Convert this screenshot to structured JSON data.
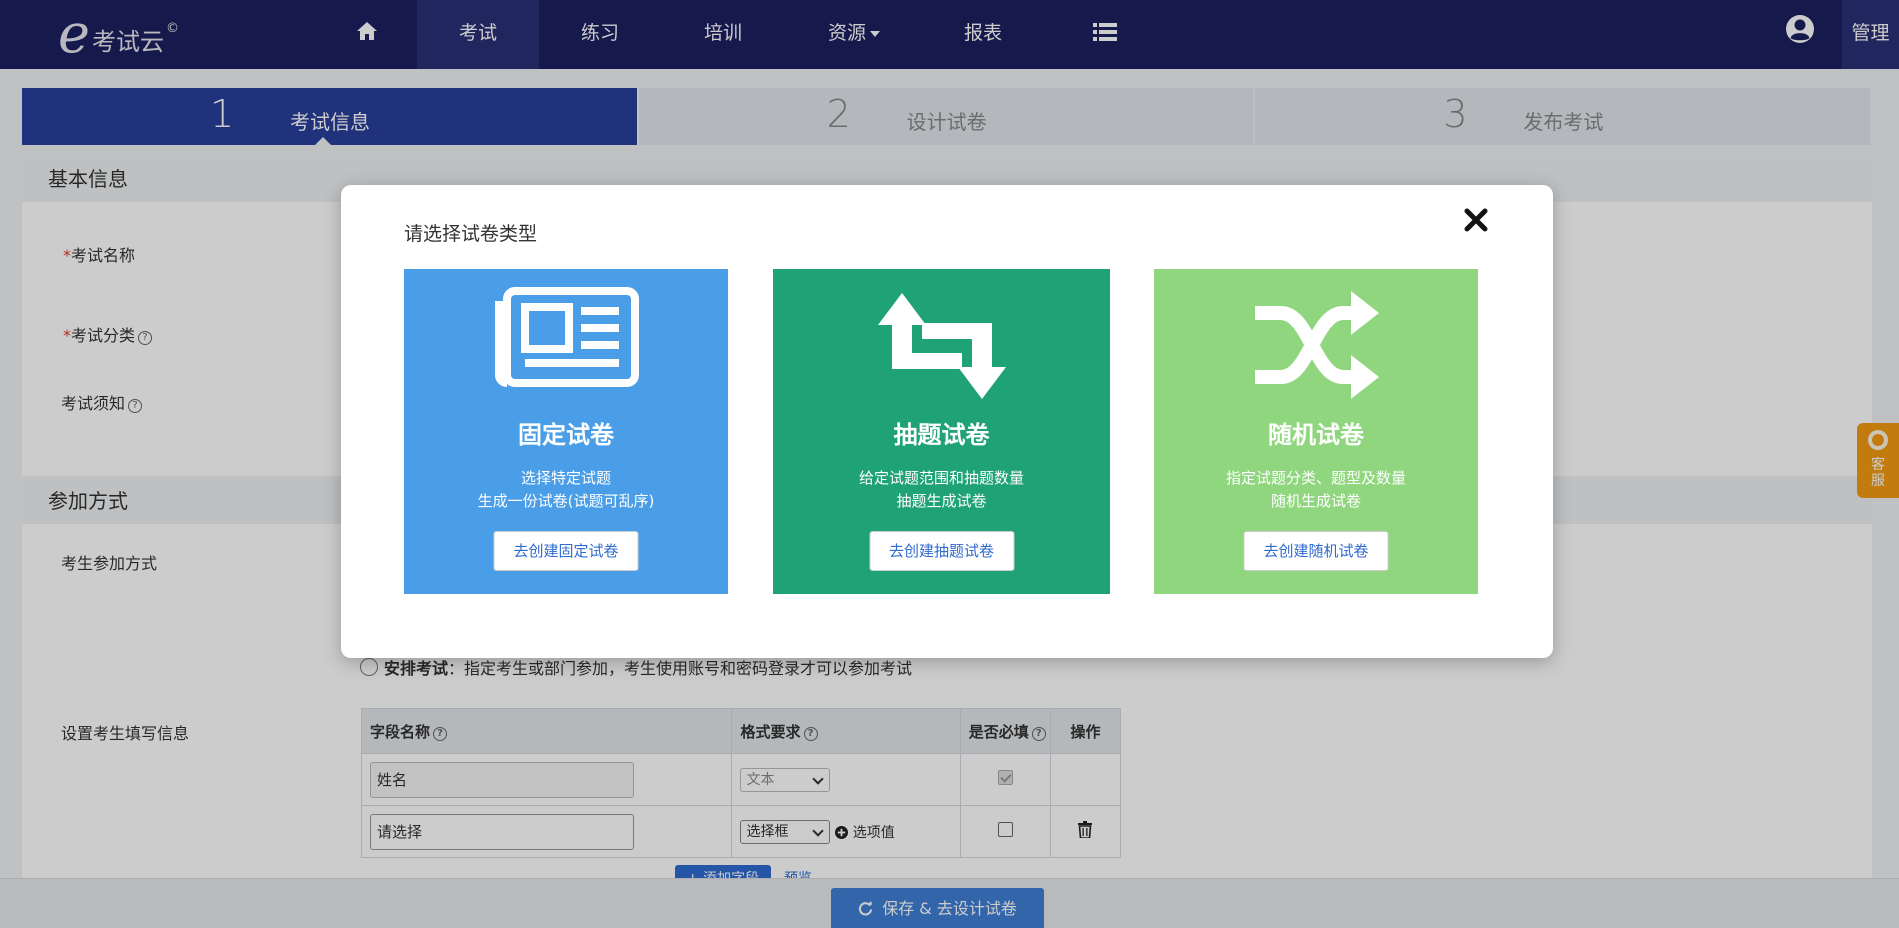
{
  "nav": {
    "logo_text": "考试云",
    "logo_mark": "©",
    "items": [
      {
        "label": ""
      },
      {
        "label": "考试"
      },
      {
        "label": "练习"
      },
      {
        "label": "培训"
      },
      {
        "label": "资源"
      },
      {
        "label": "报表"
      },
      {
        "label": ""
      }
    ],
    "manage_label": "管理"
  },
  "steps": [
    {
      "num": "1",
      "label": "考试信息"
    },
    {
      "num": "2",
      "label": "设计试卷"
    },
    {
      "num": "3",
      "label": "发布考试"
    }
  ],
  "form": {
    "basic_title": "基本信息",
    "exam_name_label": "考试名称",
    "exam_category_label": "考试分类",
    "exam_notice_label": "考试须知",
    "join_title": "参加方式",
    "join_mode_label": "考生参加方式",
    "arrange_label": "安排考试",
    "arrange_desc": "：指定考生或部门参加，考生使用账号和密码登录才可以参加考试",
    "fill_info_label": "设置考生填写信息",
    "table": {
      "headers": [
        "字段名称",
        "格式要求",
        "是否必填",
        "操作"
      ],
      "rows": [
        {
          "field": "姓名",
          "format": "文本",
          "required": true
        },
        {
          "field": "请选择",
          "format": "选择框",
          "option_link": "选项值",
          "required": false
        }
      ]
    },
    "add_field": "+ 添加字段",
    "preview": "预览",
    "save_button": "保存 & 去设计试卷"
  },
  "kefu_label": "客服",
  "modal": {
    "title": "请选择试卷类型",
    "cards": [
      {
        "title": "固定试卷",
        "line1": "选择特定试题",
        "line2": "生成一份试卷(试题可乱序)",
        "button": "去创建固定试卷",
        "color": "#4a9ee8"
      },
      {
        "title": "抽题试卷",
        "line1": "给定试题范围和抽题数量",
        "line2": "抽题生成试卷",
        "button": "去创建抽题试卷",
        "color": "#1fa276"
      },
      {
        "title": "随机试卷",
        "line1": "指定试题分类、题型及数量",
        "line2": "随机生成试卷",
        "button": "去创建随机试卷",
        "color": "#8fd67e"
      }
    ]
  }
}
